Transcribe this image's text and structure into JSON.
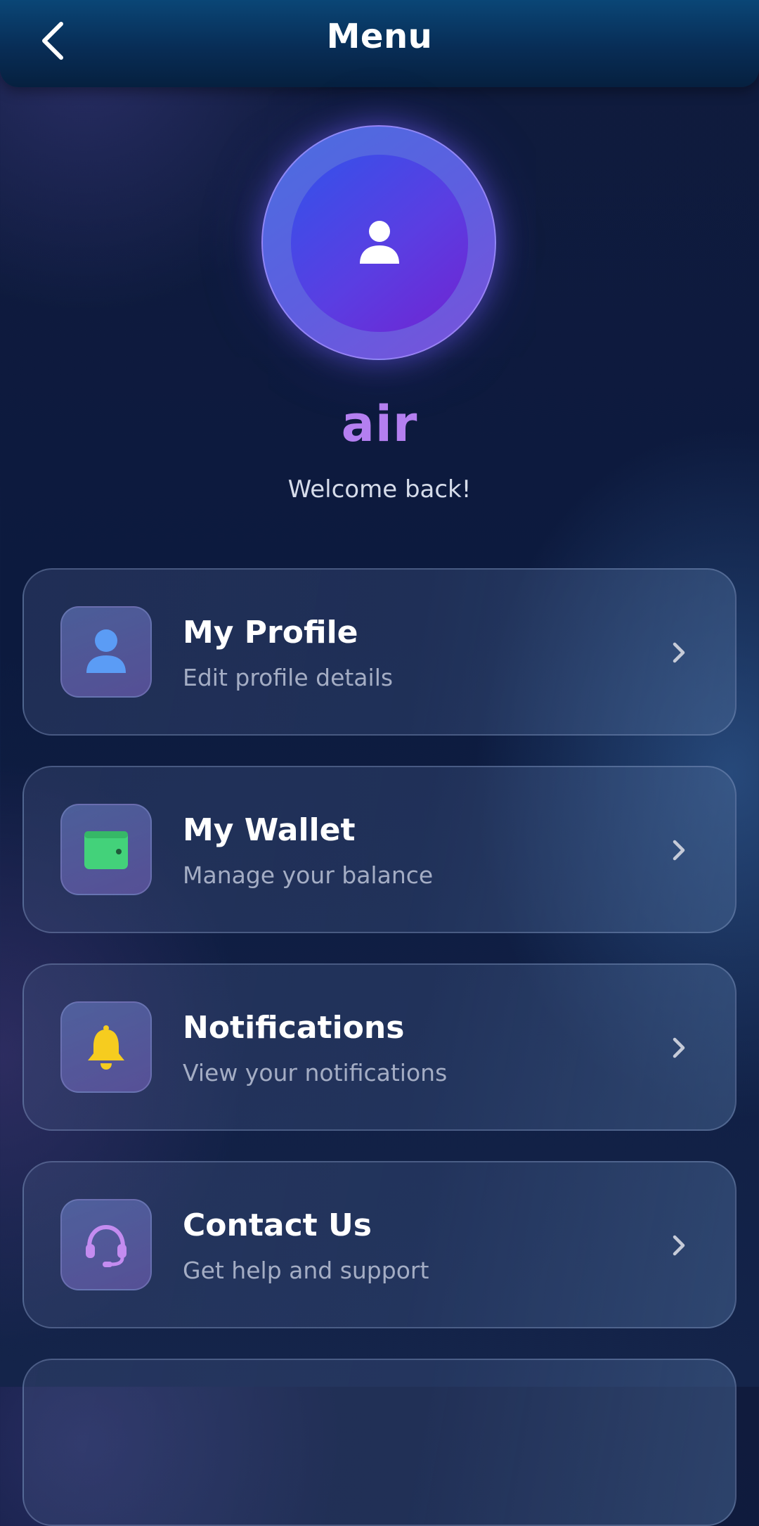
{
  "header": {
    "title": "Menu",
    "back_icon": "chevron-left-icon"
  },
  "profile": {
    "avatar_icon": "user-icon",
    "name": "air",
    "greeting": "Welcome back!"
  },
  "menu": {
    "items": [
      {
        "title": "My Profile",
        "subtitle": "Edit profile details",
        "icon": "user-icon",
        "icon_color": "#5b9cf5"
      },
      {
        "title": "My Wallet",
        "subtitle": "Manage your balance",
        "icon": "wallet-icon",
        "icon_color": "#43d27a"
      },
      {
        "title": "Notifications",
        "subtitle": "View your notifications",
        "icon": "bell-icon",
        "icon_color": "#f6cc1f"
      },
      {
        "title": "Contact Us",
        "subtitle": "Get help and support",
        "icon": "headset-icon",
        "icon_color": "#c48cf0"
      }
    ]
  },
  "colors": {
    "accent_name": "#b47ff0",
    "header_bg": "#082d56",
    "background": "#0c1a3e"
  }
}
